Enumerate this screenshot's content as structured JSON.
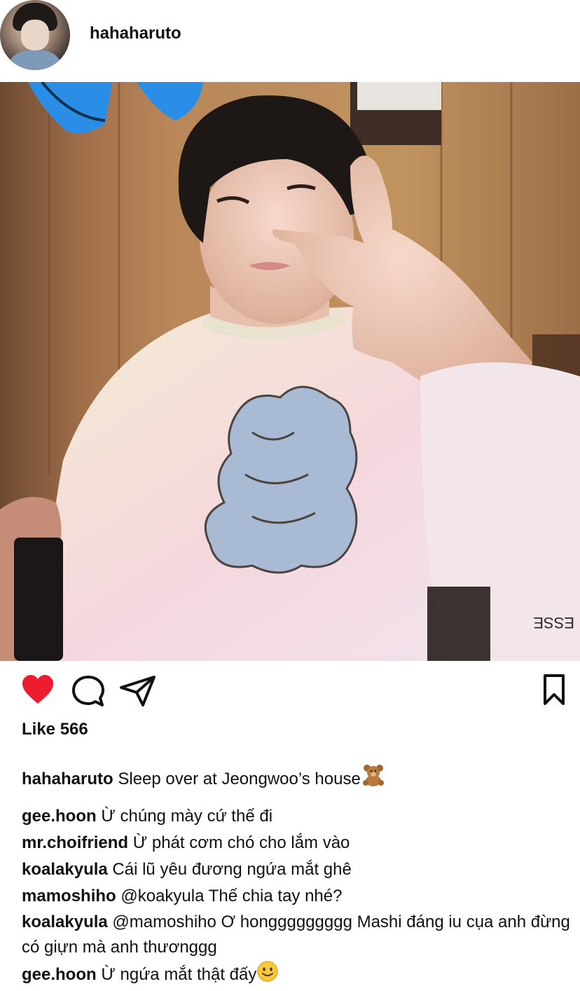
{
  "post": {
    "author": "hahaharuto",
    "likes_text": "Like 566",
    "caption": {
      "user": "hahaharuto",
      "text": "Sleep over at Jeongwoo’s house",
      "emoji": "teddy-bear"
    }
  },
  "icons": {
    "like": "heart-icon",
    "comment": "comment-icon",
    "share": "paper-plane-icon",
    "save": "bookmark-icon"
  },
  "colors": {
    "like_red": "#ed1c2e",
    "text": "#111111"
  },
  "comments": [
    {
      "user": "gee.hoon",
      "text": "Ừ chúng mày cứ thế đi"
    },
    {
      "user": "mr.choifriend",
      "text": "Ừ phát cơm chó cho lắm vào"
    },
    {
      "user": "koalakyula",
      "text": "Cái lũ yêu đương ngứa mắt ghê"
    },
    {
      "user": "mamoshiho",
      "text": "@koakyula Thế chia tay nhé?"
    },
    {
      "user": "koalakyula",
      "text": "@mamoshiho Ơ honggggggggg Mashi đáng iu cụa anh đừng có giựn mà anh thươnggg"
    },
    {
      "user": "gee.hoon",
      "text": "Ừ ngứa mắt thật đấy",
      "emoji": "slightly-smiling-face"
    }
  ],
  "photo": {
    "shirt_text": "ESSE"
  }
}
